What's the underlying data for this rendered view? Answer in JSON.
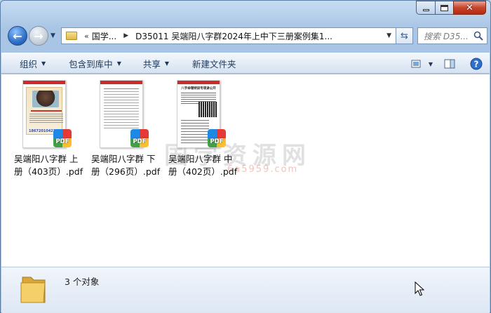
{
  "window": {
    "controls": {
      "minimize": "minimize",
      "maximize": "maximize",
      "close": "close"
    }
  },
  "nav": {
    "breadcrumb": [
      "国学...",
      "D35011 吴端阳八字群2024年上中下三册案例集1..."
    ],
    "search_placeholder": "搜索 D35...",
    "icons": {
      "back": "back-arrow-icon",
      "forward": "forward-arrow-icon",
      "refresh": "refresh-icon",
      "search": "search-icon"
    }
  },
  "toolbar": {
    "organize": "组织",
    "include_library": "包含到库中",
    "share": "共享",
    "new_folder": "新建文件夹"
  },
  "files": [
    {
      "line1": "吴端阳八字群  上",
      "line2": "册（403页）.pdf",
      "thumb_phone": "18672010423",
      "badge": "PDF"
    },
    {
      "line1": "吴端阳八字群  下",
      "line2": "册（296页）.pdf",
      "badge": "PDF"
    },
    {
      "line1": "吴端阳八字群  中",
      "line2": "册（402页）.pdf",
      "thumb_title": "八字命理特训专项讲公开",
      "badge": "PDF"
    }
  ],
  "thumb_header": "PDF",
  "watermark": {
    "main": "国学资源网",
    "sub": "6a5959.com"
  },
  "status": {
    "count": "3 个对象"
  }
}
